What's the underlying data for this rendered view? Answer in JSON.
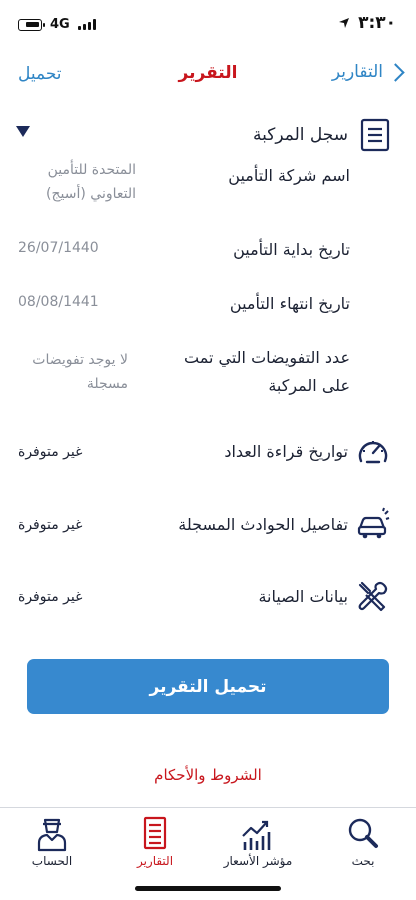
{
  "status_bar": {
    "network": "4G",
    "time": "٣:٣٠"
  },
  "header": {
    "title": "التقرير",
    "back_label": "التقارير",
    "download_label": "تحميل"
  },
  "section": {
    "title": "سجل المركبة"
  },
  "rows": [
    {
      "label": "اسم شركة التأمين",
      "value": "المتحدة للتأمين التعاوني (أسيج)"
    },
    {
      "label": "تاريخ بداية التأمين",
      "value": "26/07/1440"
    },
    {
      "label": "تاريخ انتهاء التأمين",
      "value": "08/08/1441"
    },
    {
      "label_line1": "عدد التفويضات التي تمت",
      "label_line2": "على المركبة",
      "value_line1": "لا يوجد تفويضات",
      "value_line2": "مسجلة"
    }
  ],
  "features": [
    {
      "label": "تواريخ قراءة العداد",
      "value": "غير متوفرة",
      "icon": "speedometer-icon"
    },
    {
      "label": "تفاصيل الحوادث المسجلة",
      "value": "غير متوفرة",
      "icon": "car-crash-icon"
    },
    {
      "label": "بيانات الصيانة",
      "value": "غير متوفرة",
      "icon": "tools-icon"
    }
  ],
  "download_button": {
    "label": "تحميل التقرير"
  },
  "terms": {
    "label": "الشروط والأحكام"
  },
  "tabbar": {
    "items": [
      {
        "label": "بحث",
        "icon": "search-icon"
      },
      {
        "label": "مؤشر الأسعار",
        "icon": "price-chart-icon"
      },
      {
        "label": "التقارير",
        "icon": "reports-icon",
        "active": true
      },
      {
        "label": "الحساب",
        "icon": "account-icon"
      }
    ]
  },
  "colors": {
    "accent": "#2f85c5",
    "brand_red": "#c8161d",
    "button": "#3789cf"
  }
}
